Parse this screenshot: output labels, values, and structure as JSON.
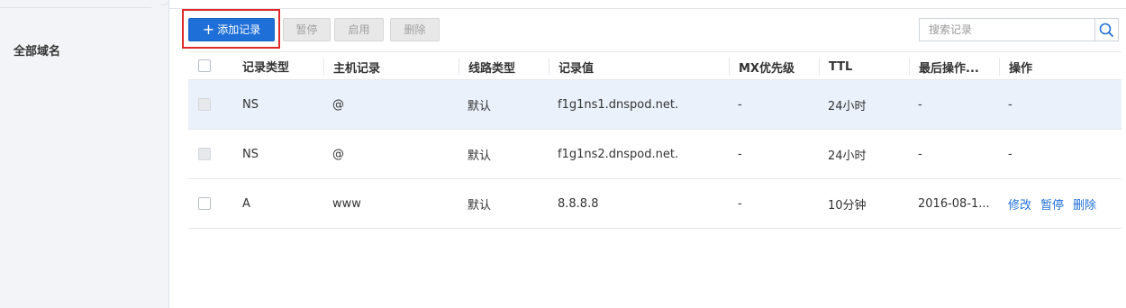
{
  "sidebar": {
    "item_all_domains": "全部域名"
  },
  "toolbar": {
    "add_record": "添加记录",
    "pause": "暂停",
    "enable": "启用",
    "delete": "删除"
  },
  "search": {
    "placeholder": "搜索记录"
  },
  "colors": {
    "primary": "#1f6fd8",
    "highlight": "#e0292a",
    "selected_row": "#eaf1fb"
  },
  "table": {
    "headers": {
      "type": "记录类型",
      "host": "主机记录",
      "line": "线路类型",
      "value": "记录值",
      "mx": "MX优先级",
      "ttl": "TTL",
      "last_op": "最后操作...",
      "actions": "操作"
    },
    "rows": [
      {
        "type": "NS",
        "host": "@",
        "line": "默认",
        "value": "f1g1ns1.dnspod.net.",
        "mx": "-",
        "ttl": "24小时",
        "last_op": "-",
        "actions": "-"
      },
      {
        "type": "NS",
        "host": "@",
        "line": "默认",
        "value": "f1g1ns2.dnspod.net.",
        "mx": "-",
        "ttl": "24小时",
        "last_op": "-",
        "actions": "-"
      },
      {
        "type": "A",
        "host": "www",
        "line": "默认",
        "value": "8.8.8.8",
        "mx": "-",
        "ttl": "10分钟",
        "last_op": "2016-08-1...",
        "action_edit": "修改",
        "action_pause": "暂停",
        "action_delete": "删除"
      }
    ]
  }
}
